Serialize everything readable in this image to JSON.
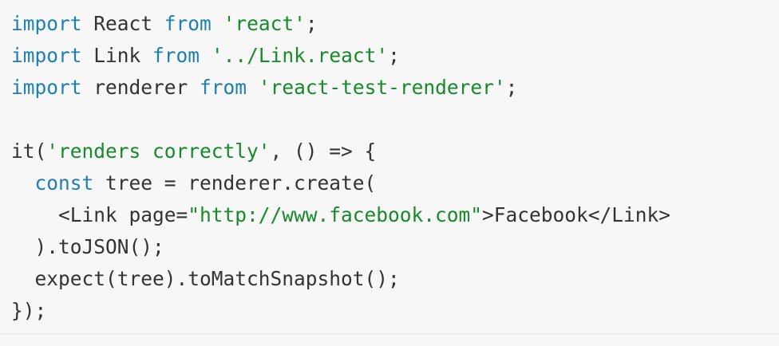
{
  "code_lines": [
    [
      {
        "type": "kw",
        "text": "import"
      },
      {
        "type": "plain",
        "text": " React "
      },
      {
        "type": "kw",
        "text": "from"
      },
      {
        "type": "plain",
        "text": " "
      },
      {
        "type": "str",
        "text": "'react'"
      },
      {
        "type": "plain",
        "text": ";"
      }
    ],
    [
      {
        "type": "kw",
        "text": "import"
      },
      {
        "type": "plain",
        "text": " Link "
      },
      {
        "type": "kw",
        "text": "from"
      },
      {
        "type": "plain",
        "text": " "
      },
      {
        "type": "str",
        "text": "'../Link.react'"
      },
      {
        "type": "plain",
        "text": ";"
      }
    ],
    [
      {
        "type": "kw",
        "text": "import"
      },
      {
        "type": "plain",
        "text": " renderer "
      },
      {
        "type": "kw",
        "text": "from"
      },
      {
        "type": "plain",
        "text": " "
      },
      {
        "type": "str",
        "text": "'react-test-renderer'"
      },
      {
        "type": "plain",
        "text": ";"
      }
    ],
    [],
    [
      {
        "type": "plain",
        "text": "it("
      },
      {
        "type": "str",
        "text": "'renders correctly'"
      },
      {
        "type": "plain",
        "text": ", () => {"
      }
    ],
    [
      {
        "type": "plain",
        "text": "  "
      },
      {
        "type": "kw",
        "text": "const"
      },
      {
        "type": "plain",
        "text": " tree = renderer.create("
      }
    ],
    [
      {
        "type": "plain",
        "text": "    <Link page="
      },
      {
        "type": "str",
        "text": "\"http://www.facebook.com\""
      },
      {
        "type": "plain",
        "text": ">Facebook</Link>"
      }
    ],
    [
      {
        "type": "plain",
        "text": "  ).toJSON();"
      }
    ],
    [
      {
        "type": "plain",
        "text": "  expect(tree).toMatchSnapshot();"
      }
    ],
    [
      {
        "type": "plain",
        "text": "});"
      }
    ]
  ],
  "colors": {
    "background": "#f7f7f7",
    "keyword": "#1f7fb3",
    "string": "#178a2a",
    "text": "#333333"
  }
}
